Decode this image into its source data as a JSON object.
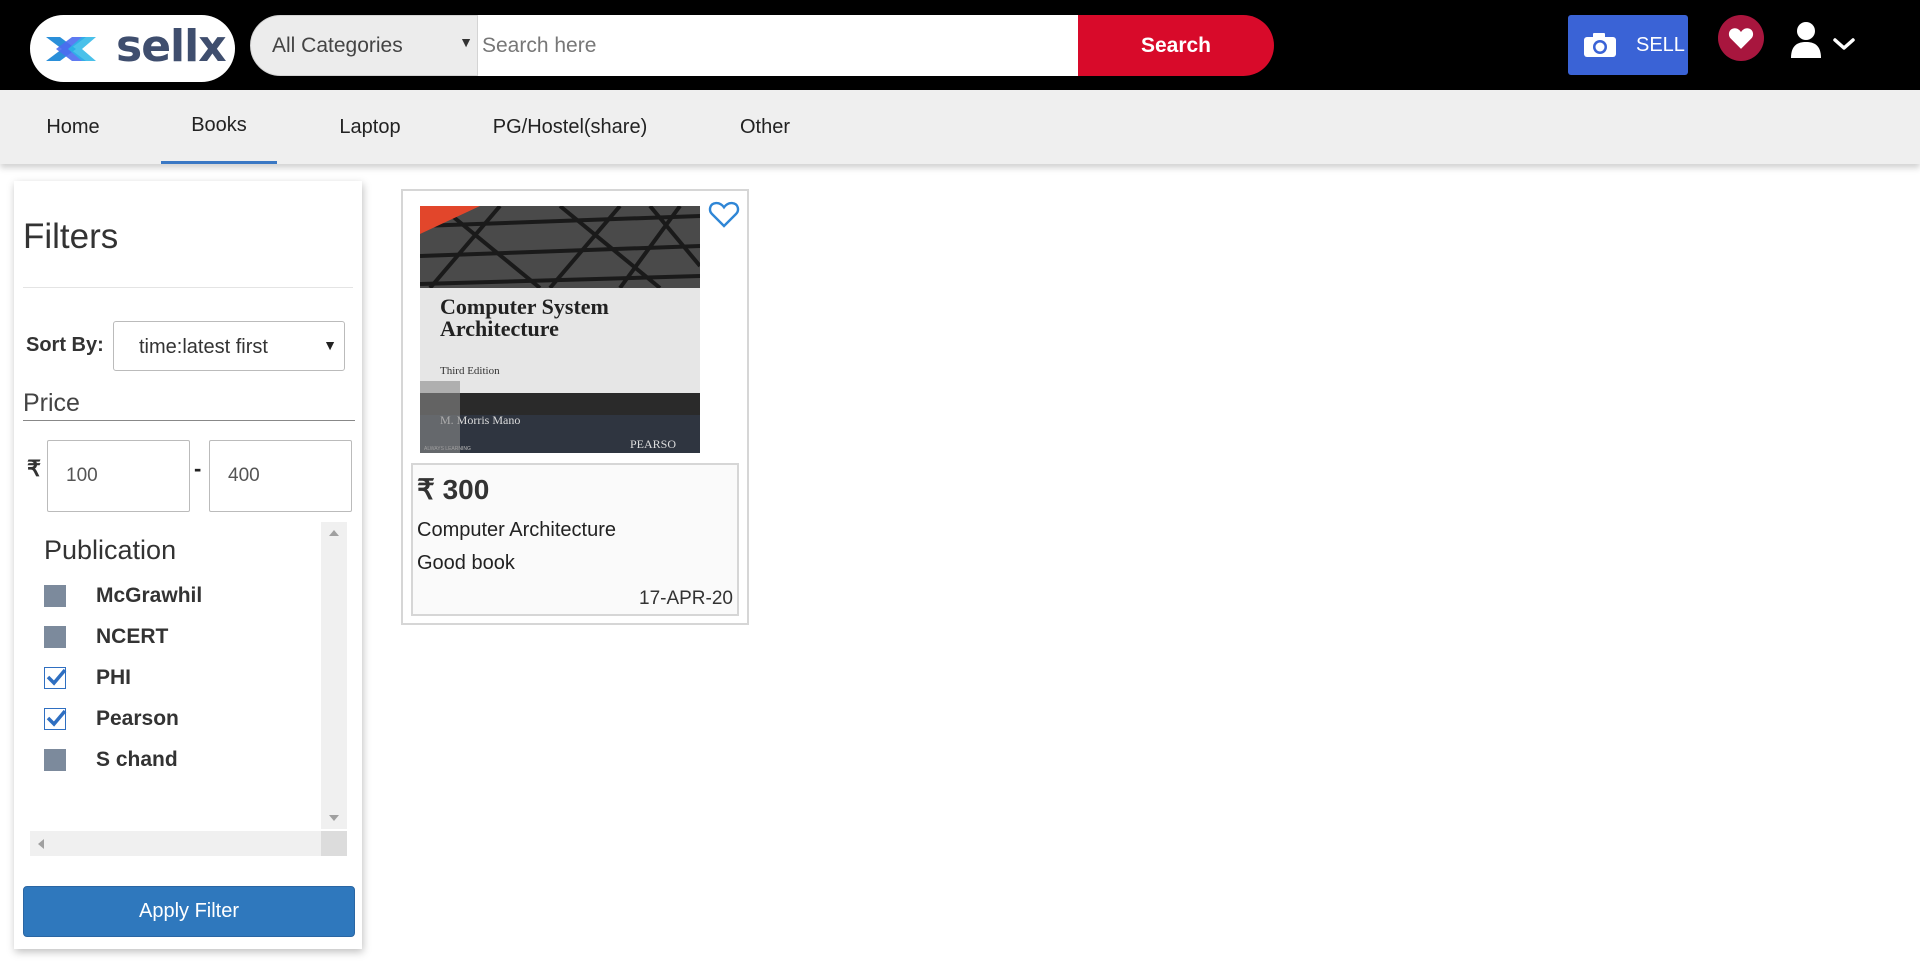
{
  "brand": {
    "name": "sellx"
  },
  "header": {
    "category_selected": "All Categories",
    "search_placeholder": "Search here",
    "search_label": "Search",
    "sell_label": "SELL"
  },
  "nav": {
    "items": [
      "Home",
      "Books",
      "Laptop",
      "PG/Hostel(share)",
      "Other"
    ],
    "active": "Books"
  },
  "filters": {
    "title": "Filters",
    "sort_label": "Sort By:",
    "sort_selected": "time:latest first",
    "price_label": "Price",
    "currency_symbol": "₹",
    "price_min": "100",
    "price_max": "400",
    "price_separator": "-",
    "publication_title": "Publication",
    "publications": [
      {
        "label": "McGrawhil",
        "checked": false
      },
      {
        "label": "NCERT",
        "checked": false
      },
      {
        "label": "PHI",
        "checked": true
      },
      {
        "label": "Pearson",
        "checked": true
      },
      {
        "label": "S chand",
        "checked": false
      }
    ],
    "apply_label": "Apply Filter"
  },
  "products": [
    {
      "price": "₹ 300",
      "title": "Computer Architecture",
      "description": "Good book",
      "date": "17-APR-20",
      "image_text": {
        "title_line1": "Computer System",
        "title_line2": "Architecture",
        "edition": "Third Edition",
        "author": "M. Morris Mano",
        "publisher": "PEARSO",
        "tagline": "ALWAYS LEARNING"
      }
    }
  ],
  "colors": {
    "topbar": "#000000",
    "search_button": "#d80a2a",
    "sell_button": "#3a63d6",
    "favorite_badge": "#a8163e",
    "apply_button": "#2f78bd",
    "nav_active_underline": "#3a78c4"
  }
}
